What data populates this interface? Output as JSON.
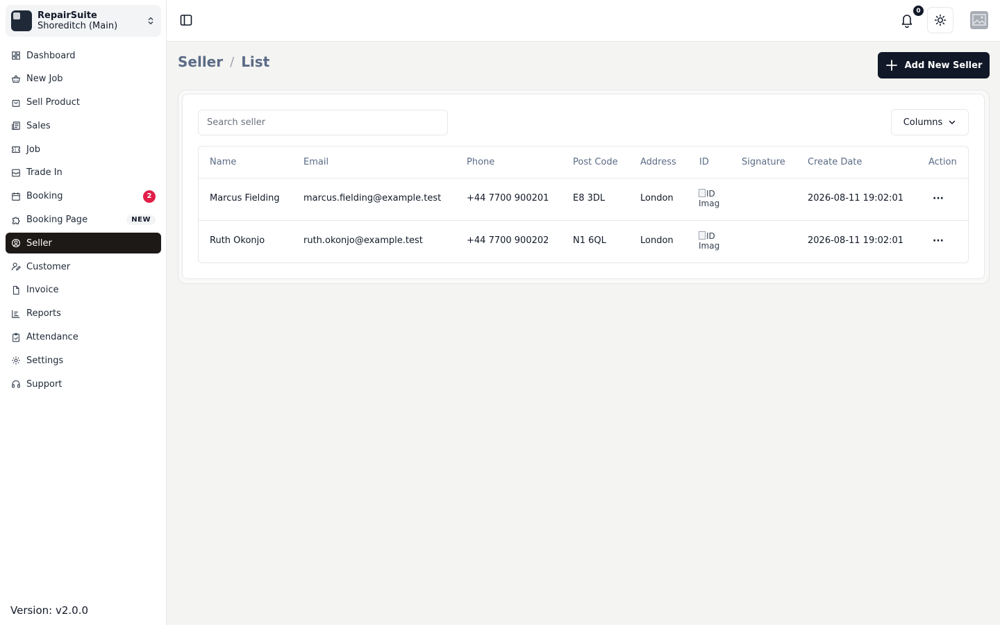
{
  "brand": {
    "name": "RepairSuite",
    "location": "Shoreditch (Main)"
  },
  "nav": [
    {
      "label": "Dashboard",
      "icon": "dashboard-icon"
    },
    {
      "label": "New Job",
      "icon": "basket-icon"
    },
    {
      "label": "Sell Product",
      "icon": "shopping-bag-icon"
    },
    {
      "label": "Sales",
      "icon": "receipt-list-icon"
    },
    {
      "label": "Job",
      "icon": "ticket-icon"
    },
    {
      "label": "Trade In",
      "icon": "archive-box-icon"
    },
    {
      "label": "Booking",
      "icon": "calendar-icon",
      "badge": "2"
    },
    {
      "label": "Booking Page",
      "icon": "puzzle-icon",
      "tag": "NEW"
    },
    {
      "label": "Seller",
      "icon": "user-circle-icon",
      "active": true
    },
    {
      "label": "Customer",
      "icon": "user-edit-icon"
    },
    {
      "label": "Invoice",
      "icon": "file-icon"
    },
    {
      "label": "Reports",
      "icon": "chart-icon"
    },
    {
      "label": "Attendance",
      "icon": "clipboard-check-icon"
    },
    {
      "label": "Settings",
      "icon": "gear-icon"
    },
    {
      "label": "Support",
      "icon": "headset-icon"
    }
  ],
  "version": "Version: v2.0.0",
  "topbar": {
    "notification_count": "0"
  },
  "breadcrumb": {
    "section": "Seller",
    "separator": "/",
    "page": "List"
  },
  "add_button": "Add New Seller",
  "search": {
    "placeholder": "Search seller",
    "value": ""
  },
  "columns_button": "Columns",
  "table": {
    "headers": [
      "Name",
      "Email",
      "Phone",
      "Post Code",
      "Address",
      "ID",
      "Signature",
      "Create Date",
      "Action"
    ],
    "rows": [
      {
        "name": "Marcus Fielding",
        "email": "marcus.fielding@example.test",
        "phone": "+44 7700 900201",
        "postcode": "E8 3DL",
        "address": "London",
        "id_alt": "ID Image",
        "signature": "",
        "created": "2026-08-11 19:02:01",
        "action": "···"
      },
      {
        "name": "Ruth Okonjo",
        "email": "ruth.okonjo@example.test",
        "phone": "+44 7700 900202",
        "postcode": "N1 6QL",
        "address": "London",
        "id_alt": "ID Image",
        "signature": "",
        "created": "2026-08-11 19:02:01",
        "action": "···"
      }
    ]
  },
  "colors": {
    "accent": "#111827",
    "active_nav": "#1c1917",
    "badge_red": "#e11d48",
    "header_text": "#5b6b86"
  }
}
